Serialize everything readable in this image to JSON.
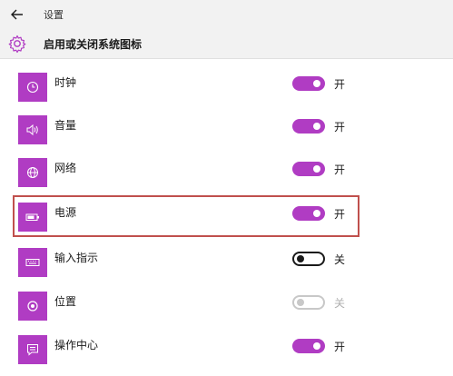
{
  "window": {
    "title": "设置",
    "back_icon": "back-arrow-icon"
  },
  "header": {
    "title": "启用或关闭系统图标",
    "icon": "gear-icon"
  },
  "colors": {
    "accent": "#b03cc3",
    "highlight_border": "#c0504d"
  },
  "items": [
    {
      "label": "时钟",
      "icon": "clock-icon",
      "toggle": "on",
      "state_label": "开",
      "enabled": true
    },
    {
      "label": "音量",
      "icon": "volume-icon",
      "toggle": "on",
      "state_label": "开",
      "enabled": true
    },
    {
      "label": "网络",
      "icon": "network-globe-icon",
      "toggle": "on",
      "state_label": "开",
      "enabled": true
    },
    {
      "label": "电源",
      "icon": "battery-icon",
      "toggle": "on",
      "state_label": "开",
      "enabled": true,
      "highlighted": true
    },
    {
      "label": "输入指示",
      "icon": "keyboard-icon",
      "toggle": "off",
      "state_label": "关",
      "enabled": true
    },
    {
      "label": "位置",
      "icon": "location-icon",
      "toggle": "off",
      "state_label": "关",
      "enabled": false
    },
    {
      "label": "操作中心",
      "icon": "action-center-icon",
      "toggle": "on",
      "state_label": "开",
      "enabled": true
    }
  ]
}
